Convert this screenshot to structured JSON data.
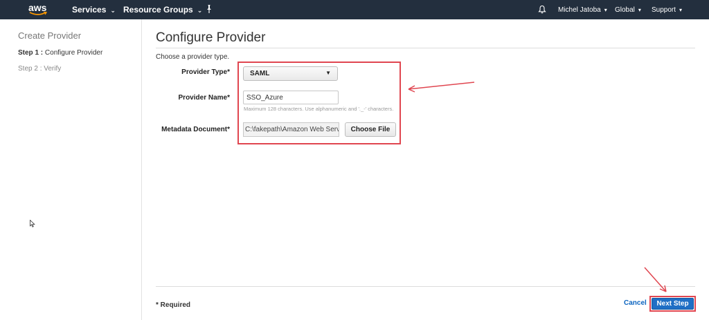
{
  "topnav": {
    "logo_text": "aws",
    "services_label": "Services",
    "resource_groups_label": "Resource Groups",
    "user_label": "Michel Jatoba",
    "region_label": "Global",
    "support_label": "Support",
    "chevron": "⌄",
    "dropdown_caret": "▾",
    "icons": [
      "pin-icon",
      "bell-icon"
    ]
  },
  "sidebar": {
    "title": "Create Provider",
    "step1_prefix": "Step 1 :",
    "step1_label": "Configure Provider",
    "step2_label": "Step 2 : Verify"
  },
  "main": {
    "title": "Configure Provider",
    "instruction": "Choose a provider type.",
    "provider_type": {
      "label": "Provider Type*",
      "value": "SAML",
      "caret": "▼"
    },
    "provider_name": {
      "label": "Provider Name*",
      "value": "SSO_Azure",
      "hint": "Maximum 128 characters. Use alphanumeric and '._-' characters."
    },
    "metadata_document": {
      "label": "Metadata Document*",
      "path": "C:\\fakepath\\Amazon Web Services",
      "choose_button": "Choose File"
    }
  },
  "footer": {
    "required_note": "* Required",
    "cancel_label": "Cancel",
    "next_label": "Next Step"
  },
  "colors": {
    "nav_bg": "#232f3e",
    "accent_blue": "#1f6fc5",
    "link_blue": "#0b64c0",
    "annotation_red": "#e0454f"
  }
}
